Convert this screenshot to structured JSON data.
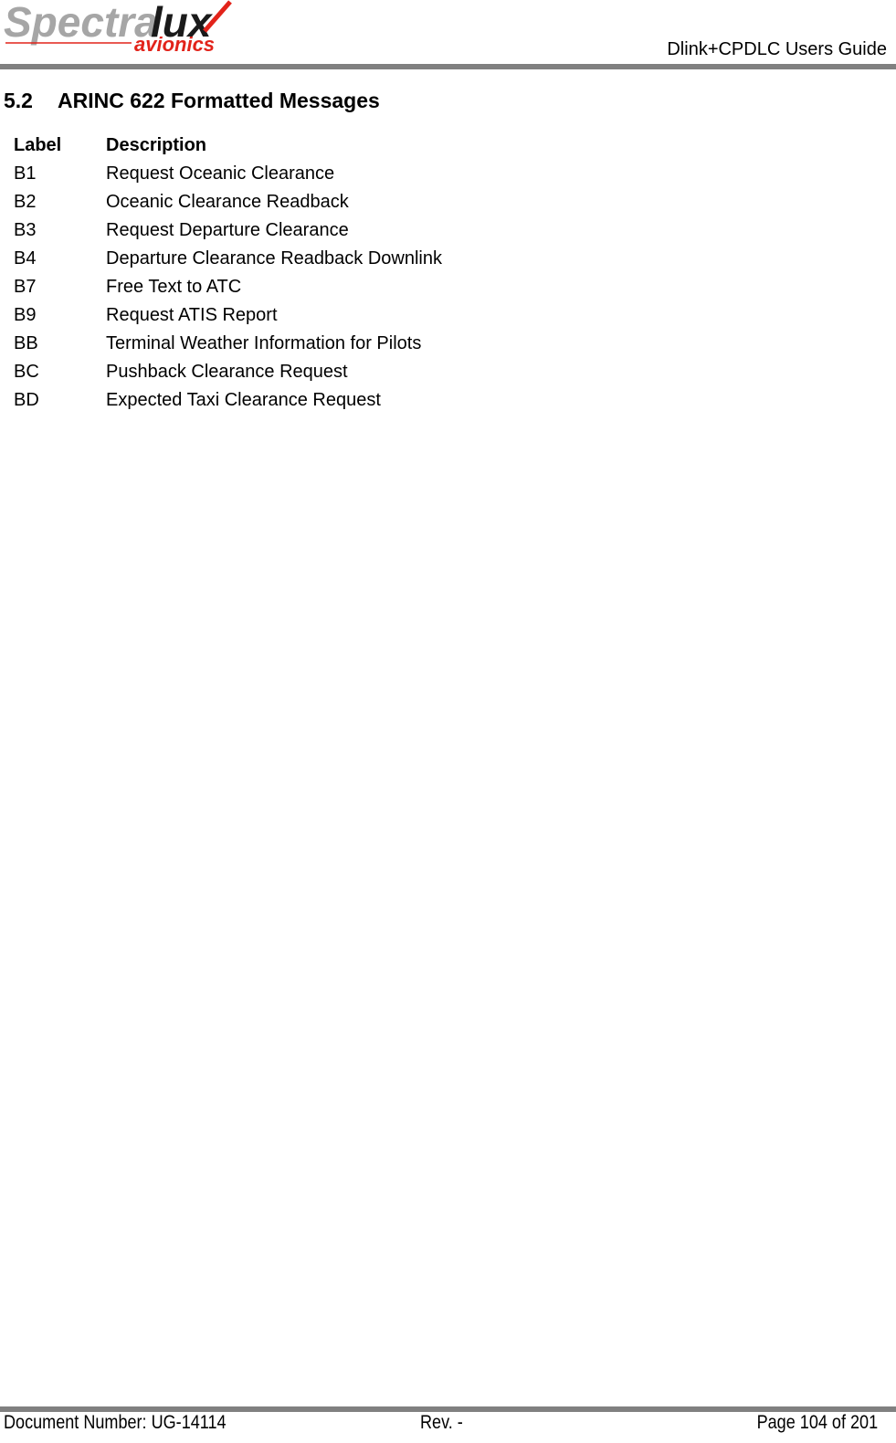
{
  "header": {
    "logo": {
      "brand_primary": "Spectra",
      "brand_accent": "lux",
      "tagline": "avionics",
      "colors": {
        "gray": "#a6a6a6",
        "black": "#1a1a1a",
        "red": "#e2231a"
      }
    },
    "doc_title": "Dlink+CPDLC Users Guide"
  },
  "section": {
    "number": "5.2",
    "title": "ARINC 622 Formatted Messages"
  },
  "table": {
    "columns": [
      "Label",
      "Description"
    ],
    "rows": [
      {
        "label": "B1",
        "description": "Request Oceanic Clearance"
      },
      {
        "label": "B2",
        "description": "Oceanic Clearance Readback"
      },
      {
        "label": "B3",
        "description": "Request Departure Clearance"
      },
      {
        "label": "B4",
        "description": "Departure Clearance Readback Downlink"
      },
      {
        "label": "B7",
        "description": "Free Text to ATC"
      },
      {
        "label": "B9",
        "description": "Request ATIS Report"
      },
      {
        "label": "BB",
        "description": "Terminal Weather Information for Pilots"
      },
      {
        "label": "BC",
        "description": "Pushback Clearance Request"
      },
      {
        "label": "BD",
        "description": "Expected Taxi Clearance Request"
      }
    ]
  },
  "footer": {
    "document_number": "Document Number:  UG-14114",
    "revision": "Rev. -",
    "page": "Page 104 of 201"
  }
}
